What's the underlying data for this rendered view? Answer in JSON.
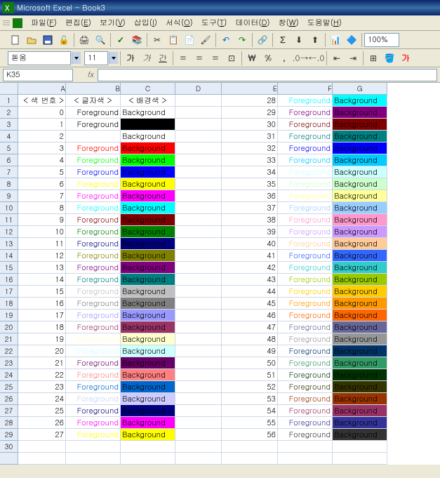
{
  "title": "Microsoft Excel - Book3",
  "menus": [
    "파일(F)",
    "편집(E)",
    "보기(V)",
    "삽입(I)",
    "서식(O)",
    "도구(T)",
    "데이터(D)",
    "창(W)",
    "도움말(H)"
  ],
  "fontname": "돋움",
  "fontsize": "11",
  "zoom": "100%",
  "namebox": "K35",
  "cols": [
    "A",
    "B",
    "C",
    "D",
    "E",
    "F",
    "G"
  ],
  "fg_label": "Foreground",
  "bg_label": "Background",
  "h_num": "< 색 번호 >",
  "h_fg": "< 글자색 >",
  "h_bg": "< 배경색 >",
  "rows": [
    {
      "n": 0,
      "fgA": true,
      "bgC": "#FFFFFF",
      "fcB": "#000000"
    },
    {
      "n": 1,
      "fgA": true,
      "bgC": "#000000",
      "fcB": "#000000"
    },
    {
      "n": 2,
      "fgA": false,
      "bgC": "#FFFFFF",
      "fcB": "#FFFFFF"
    },
    {
      "n": 3,
      "fgA": true,
      "bgC": "#FF0000",
      "fcB": "#FF0000"
    },
    {
      "n": 4,
      "fgA": true,
      "bgC": "#00FF00",
      "fcB": "#00FF00"
    },
    {
      "n": 5,
      "fgA": true,
      "bgC": "#0000FF",
      "fcB": "#0000FF"
    },
    {
      "n": 6,
      "fgA": true,
      "bgC": "#FFFF00",
      "fcB": "#FFFF00"
    },
    {
      "n": 7,
      "fgA": true,
      "bgC": "#FF00FF",
      "fcB": "#FF00FF"
    },
    {
      "n": 8,
      "fgA": true,
      "bgC": "#00FFFF",
      "fcB": "#00FFFF"
    },
    {
      "n": 9,
      "fgA": true,
      "bgC": "#800000",
      "fcB": "#800000"
    },
    {
      "n": 10,
      "fgA": true,
      "bgC": "#008000",
      "fcB": "#008000"
    },
    {
      "n": 11,
      "fgA": true,
      "bgC": "#000080",
      "fcB": "#000080"
    },
    {
      "n": 12,
      "fgA": true,
      "bgC": "#808000",
      "fcB": "#808000"
    },
    {
      "n": 13,
      "fgA": true,
      "bgC": "#800080",
      "fcB": "#800080"
    },
    {
      "n": 14,
      "fgA": true,
      "bgC": "#008080",
      "fcB": "#008080"
    },
    {
      "n": 15,
      "fgA": true,
      "bgC": "#C0C0C0",
      "fcB": "#C0C0C0"
    },
    {
      "n": 16,
      "fgA": true,
      "bgC": "#808080",
      "fcB": "#808080"
    },
    {
      "n": 17,
      "fgA": true,
      "bgC": "#9999FF",
      "fcB": "#9999FF"
    },
    {
      "n": 18,
      "fgA": true,
      "bgC": "#993366",
      "fcB": "#993366"
    },
    {
      "n": 19,
      "fgA": true,
      "bgC": "#FFFFCC",
      "fcB": "#FFFFCC"
    },
    {
      "n": 20,
      "fgA": true,
      "bgC": "#CCFFFF",
      "fcB": "#CCFFFF"
    },
    {
      "n": 21,
      "fgA": true,
      "bgC": "#660066",
      "fcB": "#660066"
    },
    {
      "n": 22,
      "fgA": true,
      "bgC": "#FF8080",
      "fcB": "#FF8080"
    },
    {
      "n": 23,
      "fgA": true,
      "bgC": "#0066CC",
      "fcB": "#0066CC"
    },
    {
      "n": 24,
      "fgA": true,
      "bgC": "#CCCCFF",
      "fcB": "#CCCCFF"
    },
    {
      "n": 25,
      "fgA": true,
      "bgC": "#000080",
      "fcB": "#000080"
    },
    {
      "n": 26,
      "fgA": true,
      "bgC": "#FF00FF",
      "fcB": "#FF00FF"
    },
    {
      "n": 27,
      "fgA": true,
      "bgC": "#FFFF00",
      "fcB": "#FFFF00"
    }
  ],
  "rowsR": [
    {
      "n": 28,
      "bgC": "#00FFFF",
      "fcB": "#00FFFF"
    },
    {
      "n": 29,
      "bgC": "#800080",
      "fcB": "#800080"
    },
    {
      "n": 30,
      "bgC": "#800000",
      "fcB": "#800000"
    },
    {
      "n": 31,
      "bgC": "#008080",
      "fcB": "#008080"
    },
    {
      "n": 32,
      "bgC": "#0000FF",
      "fcB": "#0000FF"
    },
    {
      "n": 33,
      "bgC": "#00CCFF",
      "fcB": "#00CCFF"
    },
    {
      "n": 34,
      "bgC": "#CCFFFF",
      "fcB": "#CCFFFF"
    },
    {
      "n": 35,
      "bgC": "#CCFFCC",
      "fcB": "#CCFFCC"
    },
    {
      "n": 36,
      "bgC": "#FFFF99",
      "fcB": "#FFFF99"
    },
    {
      "n": 37,
      "bgC": "#99CCFF",
      "fcB": "#99CCFF"
    },
    {
      "n": 38,
      "bgC": "#FF99CC",
      "fcB": "#FF99CC"
    },
    {
      "n": 39,
      "bgC": "#CC99FF",
      "fcB": "#CC99FF"
    },
    {
      "n": 40,
      "bgC": "#FFCC99",
      "fcB": "#FFCC99"
    },
    {
      "n": 41,
      "bgC": "#3366FF",
      "fcB": "#3366FF"
    },
    {
      "n": 42,
      "bgC": "#33CCCC",
      "fcB": "#33CCCC"
    },
    {
      "n": 43,
      "bgC": "#99CC00",
      "fcB": "#99CC00"
    },
    {
      "n": 44,
      "bgC": "#FFCC00",
      "fcB": "#FFCC00"
    },
    {
      "n": 45,
      "bgC": "#FF9900",
      "fcB": "#FF9900"
    },
    {
      "n": 46,
      "bgC": "#FF6600",
      "fcB": "#FF6600"
    },
    {
      "n": 47,
      "bgC": "#666699",
      "fcB": "#666699"
    },
    {
      "n": 48,
      "bgC": "#969696",
      "fcB": "#969696"
    },
    {
      "n": 49,
      "bgC": "#003366",
      "fcB": "#003366"
    },
    {
      "n": 50,
      "bgC": "#339966",
      "fcB": "#339966"
    },
    {
      "n": 51,
      "bgC": "#003300",
      "fcB": "#003300"
    },
    {
      "n": 52,
      "bgC": "#333300",
      "fcB": "#333300"
    },
    {
      "n": 53,
      "bgC": "#993300",
      "fcB": "#993300"
    },
    {
      "n": 54,
      "bgC": "#993366",
      "fcB": "#993366"
    },
    {
      "n": 55,
      "bgC": "#333399",
      "fcB": "#333399"
    },
    {
      "n": 56,
      "bgC": "#333333",
      "fcB": "#333333"
    }
  ]
}
